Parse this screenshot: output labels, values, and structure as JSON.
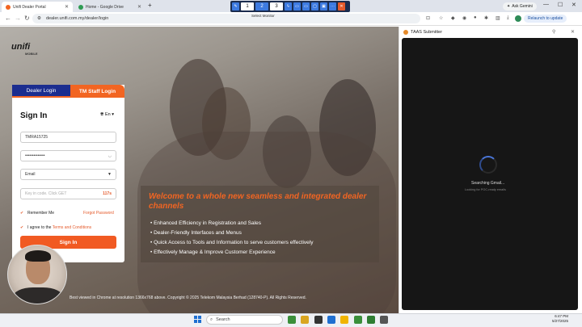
{
  "browser": {
    "tabs": [
      {
        "title": "Unifi Dealer Portal",
        "active": true
      },
      {
        "title": "Home - Google Drive",
        "active": false
      }
    ],
    "url": "dealer.unifi.com.my/dealer/login",
    "ask_gemini": "Ask Gemini",
    "relaunch": "Relaunch to update"
  },
  "sharebar": {
    "monitors": [
      "1",
      "2",
      "3"
    ],
    "selected_monitor": "2",
    "select_label": "Select Monitor"
  },
  "page": {
    "logo": "unifi",
    "logo_sub": "MOBILE",
    "tabs": {
      "dealer": "Dealer Login",
      "staff": "TM Staff Login"
    },
    "signin_title": "Sign In",
    "language": "En",
    "username": "TMRA15725",
    "password_mask": "••••••••••••••",
    "method": "Email",
    "otp_placeholder": "Key in code. Click GET",
    "otp_timer": "117s",
    "remember_me": "Remember Me",
    "forgot_password": "Forgot Password",
    "agree_prefix": "I agree to the",
    "terms_link": "Terms and Conditions",
    "signin_button": "Sign In",
    "promo_title": "Welcome to a whole new seamless and integrated dealer channels",
    "bullets": [
      "Enhanced Efficiency in Registration and Sales",
      "Dealer-Friendly Interfaces and Menus",
      "Quick Access to Tools and Information to serve customers effectively",
      "Effectively Manage & Improve Customer Experience"
    ],
    "footer": "Best viewed in Chrome at resolution 1366x768 above. Copyright © 2025 Telekom Malaysia Berhad (128740-P). All Rights Reserved."
  },
  "side_panel": {
    "title": "TAAS Submitter",
    "status": "Searching Gmail...",
    "substatus": "Looking for POC-ready emails"
  },
  "taskbar": {
    "search": "Search",
    "time": "6:47 PM",
    "date": "5/27/2025"
  },
  "colors": {
    "accent": "#f26522",
    "brand_blue": "#1b2d8f",
    "spinner": "#4a76d8"
  }
}
